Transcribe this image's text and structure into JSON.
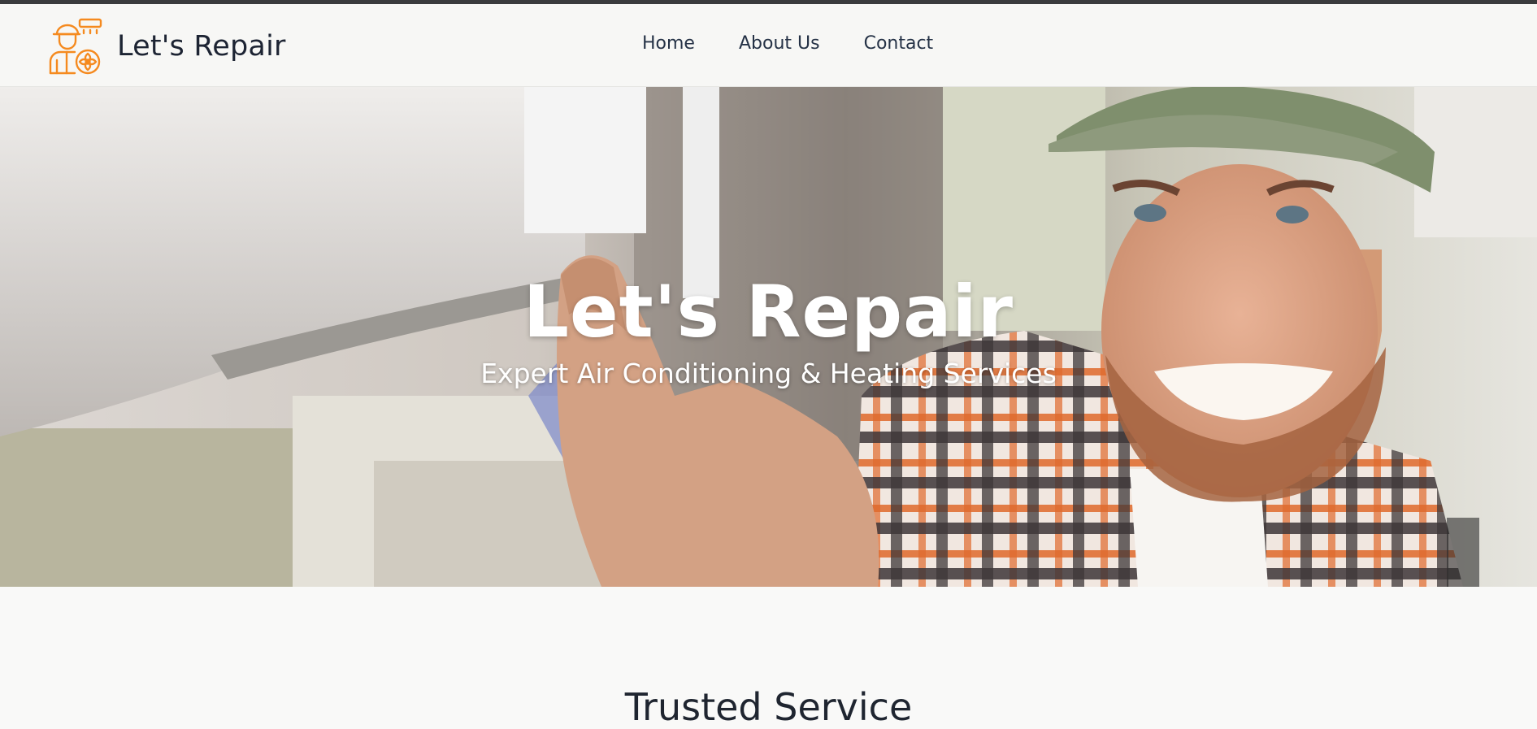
{
  "colors": {
    "brand_accent": "#f58a1f",
    "nav_text": "#253246",
    "navbar_bg": "#f7f7f5",
    "page_bg": "#f9f9f8",
    "top_strip": "#3a3b3d"
  },
  "header": {
    "logo_icon": "technician-with-fan-icon",
    "brand_name": "Let's Repair",
    "nav": [
      {
        "label": "Home"
      },
      {
        "label": "About Us"
      },
      {
        "label": "Contact"
      }
    ]
  },
  "hero": {
    "image": "technician-servicing-air-conditioner-photo",
    "title": "Let's Repair",
    "subtitle": "Expert Air Conditioning & Heating Services"
  },
  "section": {
    "title": "Trusted Service"
  }
}
